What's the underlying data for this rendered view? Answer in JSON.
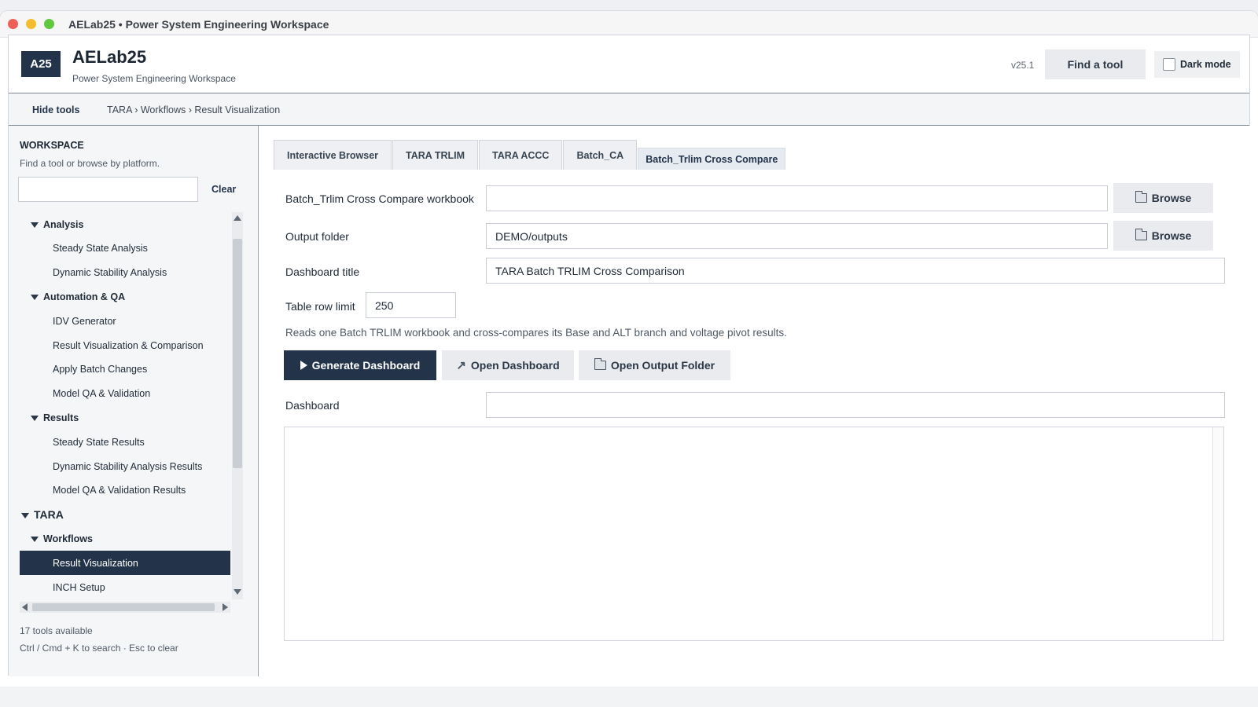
{
  "window": {
    "title": "AELab25 • Power System Engineering Workspace"
  },
  "header": {
    "logo": "A25",
    "app_name": "AELab25",
    "app_subtitle": "Power System Engineering Workspace",
    "version": "v25.1",
    "find_tool_label": "Find a tool",
    "dark_mode_label": "Dark mode"
  },
  "crumbbar": {
    "hide_tools_label": "Hide tools",
    "breadcrumb": "TARA › Workflows › Result Visualization"
  },
  "sidebar": {
    "title": "WORKSPACE",
    "subtitle": "Find a tool or browse by platform.",
    "search_value": "",
    "clear_label": "Clear",
    "tree": [
      {
        "label": "Analysis",
        "level": 2
      },
      {
        "label": "Steady State Analysis",
        "level": 3
      },
      {
        "label": "Dynamic Stability Analysis",
        "level": 3
      },
      {
        "label": "Automation & QA",
        "level": 2
      },
      {
        "label": "IDV Generator",
        "level": 3
      },
      {
        "label": "Result Visualization & Comparison",
        "level": 3
      },
      {
        "label": "Apply Batch Changes",
        "level": 3
      },
      {
        "label": "Model QA & Validation",
        "level": 3
      },
      {
        "label": "Results",
        "level": 2
      },
      {
        "label": "Steady State Results",
        "level": 3
      },
      {
        "label": "Dynamic Stability Analysis Results",
        "level": 3
      },
      {
        "label": "Model QA & Validation Results",
        "level": 3
      },
      {
        "label": "TARA",
        "level": 1
      },
      {
        "label": "Workflows",
        "level": 2
      },
      {
        "label": "Result Visualization",
        "level": 3,
        "selected": true
      },
      {
        "label": "INCH Setup",
        "level": 3
      }
    ],
    "tools_count": "17 tools available",
    "shortcut_hint": "Ctrl / Cmd + K to search · Esc to clear"
  },
  "main": {
    "tabs": [
      {
        "label": "Interactive Browser",
        "active": false
      },
      {
        "label": "TARA TRLIM",
        "active": false
      },
      {
        "label": "TARA ACCC",
        "active": false
      },
      {
        "label": "Batch_CA",
        "active": false
      },
      {
        "label": "Batch_Trlim Cross Compare",
        "active": true
      }
    ],
    "workbook_label": "Batch_Trlim Cross Compare workbook",
    "workbook_value": "",
    "browse_label": "Browse",
    "output_label": "Output folder",
    "output_value": "DEMO/outputs",
    "title_label": "Dashboard title",
    "title_value": "TARA Batch TRLIM Cross Comparison",
    "row_limit_label": "Table row limit",
    "row_limit_value": "250",
    "description": "Reads one Batch TRLIM workbook and cross-compares its Base and ALT branch and voltage pivot results.",
    "generate_label": "Generate Dashboard",
    "open_dashboard_label": "Open Dashboard",
    "open_folder_label": "Open Output Folder",
    "dashboard_label": "Dashboard",
    "dashboard_value": ""
  },
  "colors": {
    "accent": "#23344a",
    "button_bg": "#e9ebee"
  }
}
